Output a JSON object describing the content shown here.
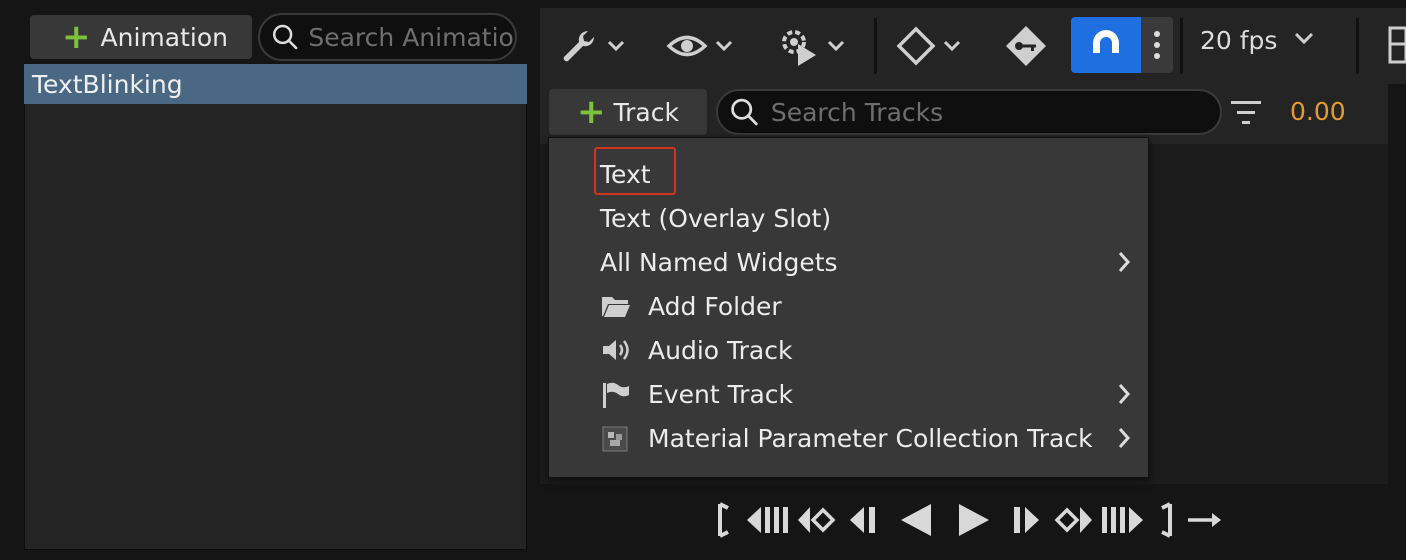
{
  "animations_panel": {
    "add_button_label": "Animation",
    "search_placeholder": "Search Animations",
    "items": [
      "TextBlinking"
    ]
  },
  "toolbar": {
    "icons": [
      "wrench-icon",
      "eye-icon",
      "gear-play-icon",
      "keyframe-diamond-icon",
      "key-icon",
      "magnet-icon",
      "more-vertical-icon"
    ],
    "fps_label": "20 fps",
    "accent_color": "#1f6fe0"
  },
  "tracks": {
    "add_button_label": "Track",
    "search_placeholder": "Search Tracks",
    "time_value": "0.00",
    "time_color": "#e89a2c"
  },
  "track_menu": {
    "items": [
      {
        "label": "Text",
        "icon": "",
        "submenu": false,
        "highlighted": true
      },
      {
        "label": "Text (Overlay Slot)",
        "icon": "",
        "submenu": false
      },
      {
        "label": "All Named Widgets",
        "icon": "",
        "submenu": true
      },
      {
        "label": "Add Folder",
        "icon": "folder-icon",
        "submenu": false
      },
      {
        "label": "Audio Track",
        "icon": "speaker-icon",
        "submenu": false
      },
      {
        "label": "Event Track",
        "icon": "flag-icon",
        "submenu": true
      },
      {
        "label": "Material Parameter Collection Track",
        "icon": "material-collection-icon",
        "submenu": true
      }
    ],
    "highlight_color": "#d0341f"
  },
  "transport": {
    "icons": [
      "jump-to-start-icon",
      "step-back-many-icon",
      "prev-key-icon",
      "step-back-icon",
      "play-reverse-icon",
      "play-icon",
      "step-forward-icon",
      "next-key-icon",
      "step-forward-many-icon",
      "jump-to-end-icon",
      "loop-icon"
    ]
  }
}
